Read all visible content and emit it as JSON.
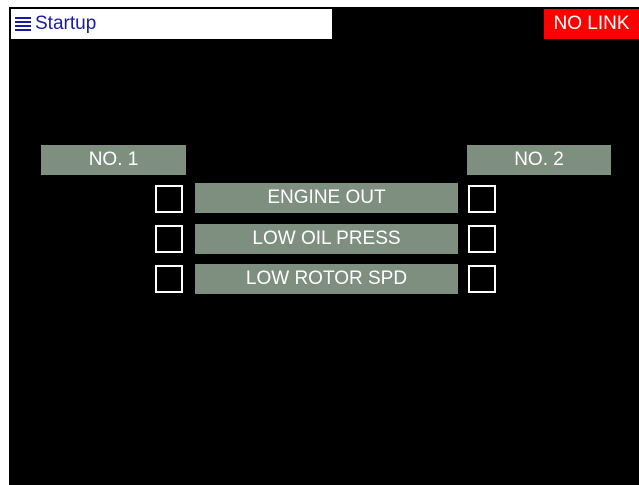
{
  "title_bar": {
    "icon": "menu-icon",
    "title": "Startup"
  },
  "link_status": {
    "label": "NO LINK",
    "color": "#ff0000"
  },
  "engines": {
    "no1_label": "NO. 1",
    "no2_label": "NO. 2"
  },
  "warnings": [
    {
      "label": "ENGINE OUT",
      "no1_checked": false,
      "no2_checked": false
    },
    {
      "label": "LOW OIL PRESS",
      "no1_checked": false,
      "no2_checked": false
    },
    {
      "label": "LOW ROTOR SPD",
      "no1_checked": false,
      "no2_checked": false
    }
  ],
  "colors": {
    "background": "#000000",
    "label_fill": "#7f8f7f",
    "title_text": "#1a1aa6"
  }
}
